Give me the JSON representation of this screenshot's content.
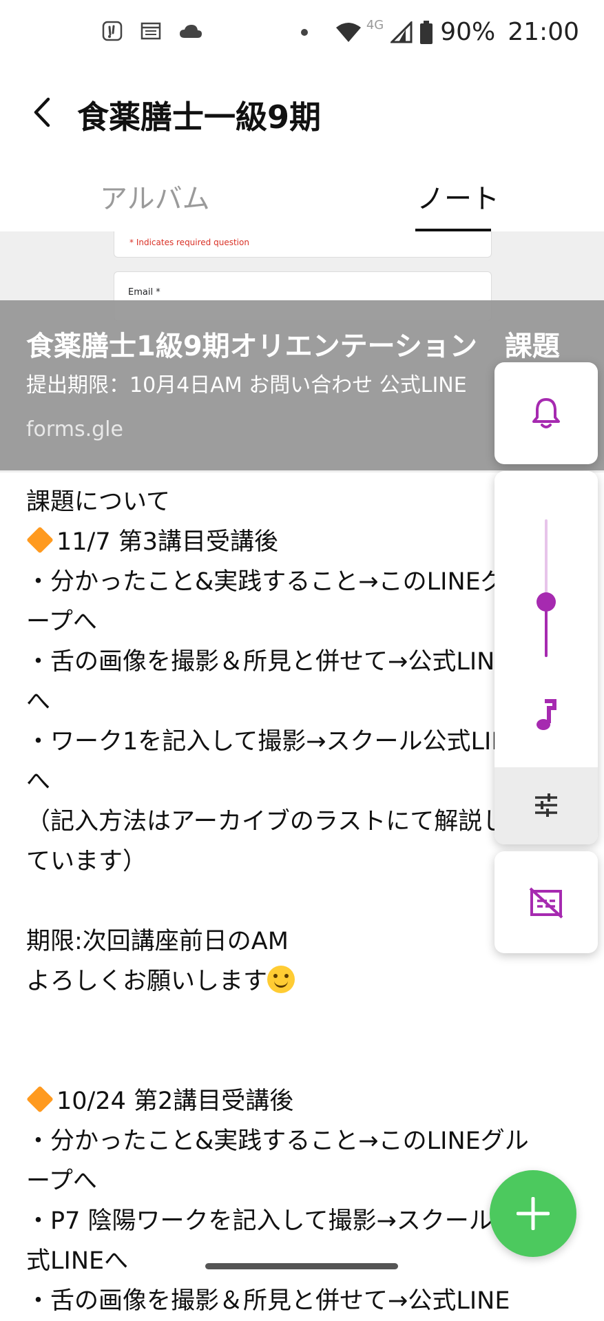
{
  "status_bar": {
    "battery_percent": "90%",
    "time": "21:00",
    "network": "4G",
    "icons": [
      "app-notification-icon",
      "calendar-icon",
      "cloud-icon",
      "dot-icon",
      "wifi-icon",
      "signal-icon",
      "battery-icon"
    ]
  },
  "header": {
    "title": "食薬膳士一級9期",
    "back_icon": "chevron-left-icon"
  },
  "tabs": [
    {
      "label": "アルバム",
      "active": false
    },
    {
      "label": "ノート",
      "active": true
    }
  ],
  "link_preview": {
    "form_required_text": "* Indicates required question",
    "form_email_label": "Email *",
    "title": "食薬膳士1級9期オリエンテーション　課題",
    "subtitle": "提出期限：10月4日AM  お問い合わせ 公式LINE",
    "domain": "forms.gle"
  },
  "note_lines": [
    "課題について",
    "11/7 第3講目受講後",
    "・分かったこと&実践すること→このLINEグル",
    "ープへ",
    "・舌の画像を撮影＆所見と併せて→公式LINE",
    "へ",
    "・ワーク1を記入して撮影→スクール公式LINE",
    "へ",
    "（記入方法はアーカイブのラストにて解説し",
    "ています）",
    "",
    "期限:次回講座前日のAM",
    "よろしくお願いします",
    "",
    "",
    "10/24 第2講目受講後",
    "・分かったこと&実践すること→このLINEグル",
    "ープへ",
    "・P7 陰陽ワークを記入して撮影→スクール公",
    "式LINEへ",
    "・舌の画像を撮影＆所見と併せて→公式LINE"
  ],
  "volume_panel": {
    "level": 0.4,
    "icons": [
      "bell-icon",
      "music-note-icon",
      "equalizer-settings-icon",
      "captions-off-icon"
    ]
  },
  "fab": {
    "label": "+",
    "icon": "plus-icon"
  },
  "colors": {
    "accent_purple": "#a62ab0",
    "fab_green": "#4cc95e",
    "overlay_gray": "#969696",
    "diamond_orange": "#ff9a1f"
  }
}
